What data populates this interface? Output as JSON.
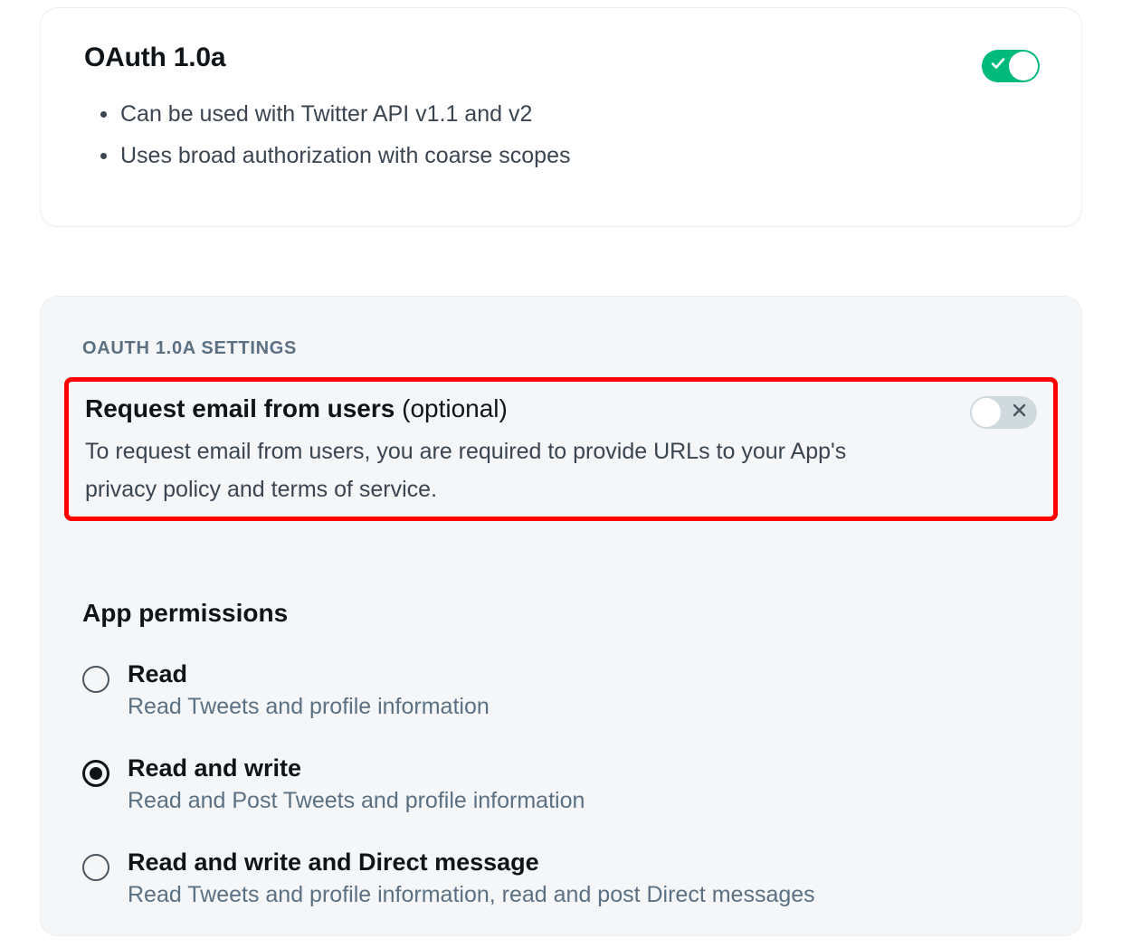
{
  "oauth_card": {
    "title": "OAuth 1.0a",
    "bullets": [
      "Can be used with Twitter API v1.1 and v2",
      "Uses broad authorization with coarse scopes"
    ],
    "toggle_on": true
  },
  "settings": {
    "section_label": "OAUTH 1.0A SETTINGS",
    "request_email": {
      "title_strong": "Request email from users",
      "title_suffix": "(optional)",
      "description": "To request email from users, you are required to provide URLs to your App's privacy policy and terms of service.",
      "toggle_on": false
    },
    "permissions": {
      "heading": "App permissions",
      "selected": "read_write",
      "options": [
        {
          "id": "read",
          "label": "Read",
          "desc": "Read Tweets and profile information"
        },
        {
          "id": "read_write",
          "label": "Read and write",
          "desc": "Read and Post Tweets and profile information"
        },
        {
          "id": "read_write_dm",
          "label": "Read and write and Direct message",
          "desc": "Read Tweets and profile information, read and post Direct messages"
        }
      ]
    }
  }
}
